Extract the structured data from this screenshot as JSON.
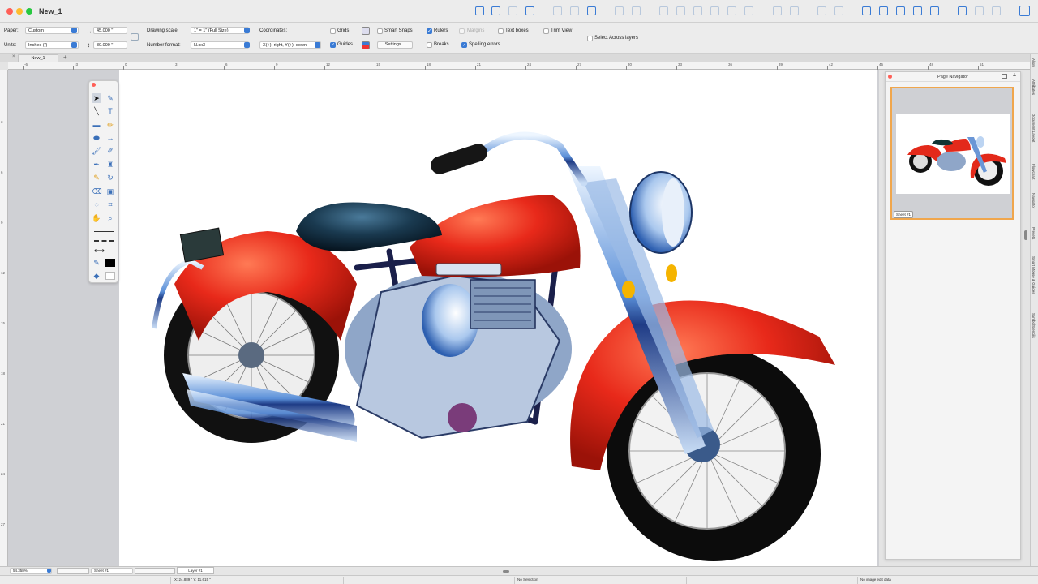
{
  "window": {
    "title": "New_1"
  },
  "controls": {
    "paper_label": "Paper:",
    "paper_value": "Custom",
    "units_label": "Units:",
    "units_value": "Inches (\")",
    "width_value": "45.000 \"",
    "height_value": "30.000 \"",
    "drawing_scale_label": "Drawing scale:",
    "drawing_scale_value": "1\" = 1\"   (Full Size)",
    "number_format_label": "Number format:",
    "number_format_value": "N.xx3",
    "coordinates_label": "Coordinates:",
    "coordinates_value": "X(+): right, Y(+): down",
    "grids_label": "Grids",
    "guides_label": "Guides",
    "smart_snaps_label": "Smart Snaps",
    "settings_button": "Settings...",
    "rulers_label": "Rulers",
    "breaks_label": "Breaks",
    "margins_label": "Margins",
    "spelling_label": "Spelling errors",
    "text_boxes_label": "Text boxes",
    "trim_view_label": "Trim View",
    "select_across_label": "Select Across layers"
  },
  "tab": {
    "name": "New_1"
  },
  "ruler": {
    "labels": [
      "-6",
      "-3",
      "0",
      "3",
      "6",
      "9",
      "12",
      "15",
      "18",
      "21",
      "24",
      "27",
      "30",
      "33",
      "36",
      "39",
      "42",
      "45",
      "48",
      "51"
    ]
  },
  "vruler": {
    "labels": [
      "3",
      "6",
      "9",
      "12",
      "15",
      "18",
      "21",
      "24",
      "27"
    ]
  },
  "navigator": {
    "title": "Page Navigator",
    "sheet_label": "Sheet #1"
  },
  "sidebar_tabs": [
    "Align",
    "Attributes",
    "Document Layout",
    "Flowchart",
    "Navigator",
    "Presets",
    "Smart Mouse & Guides",
    "SymbolStencils"
  ],
  "bottom": {
    "zoom": "54.358%",
    "sheet": "Sheet #1",
    "layer": "Layer #1"
  },
  "status": {
    "coords": "X: 24.889 \"     Y: 11.615 \"",
    "selection": "No Selection",
    "image_edit": "No image edit data"
  }
}
